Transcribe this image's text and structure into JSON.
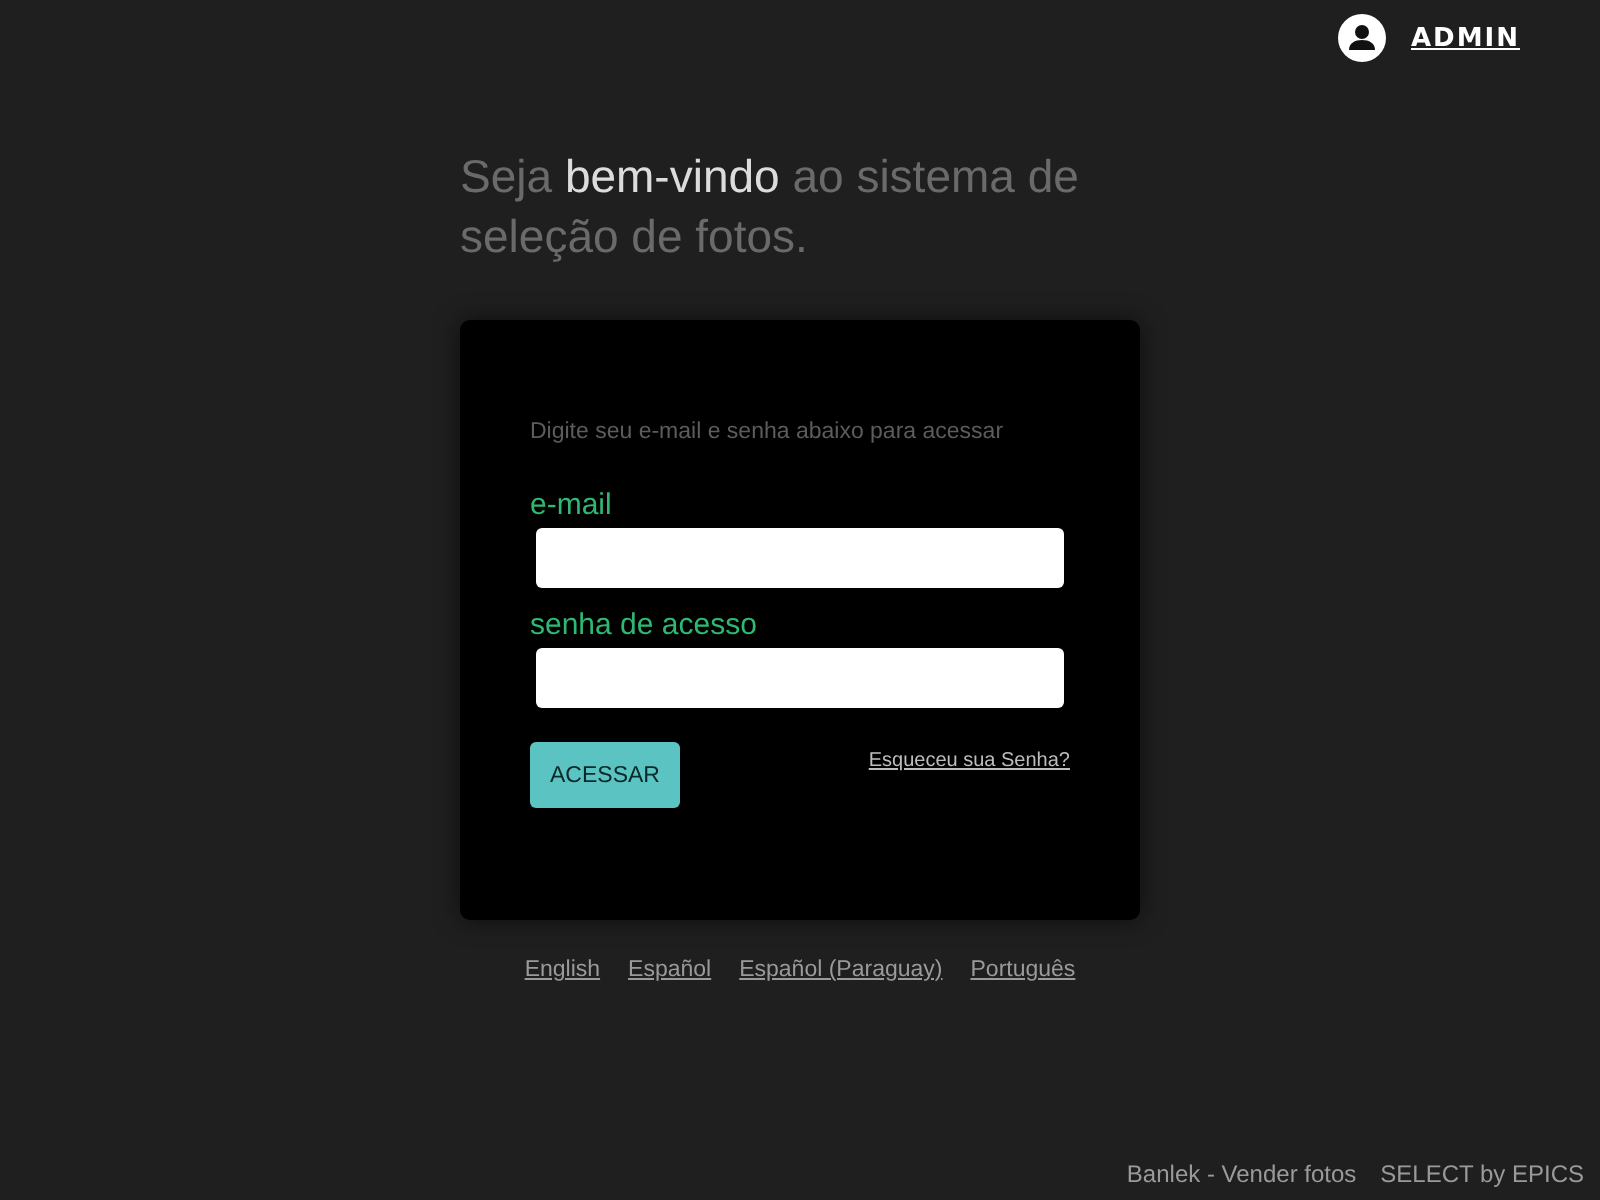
{
  "header": {
    "user": "ADMIN"
  },
  "welcome": "Seja **bem-vindo** ao sistema de seleção de fotos.",
  "login": {
    "instructions": "Digite seu e-mail e senha abaixo para acessar",
    "fields": [
      {
        "label": "e-mail"
      },
      {
        "label": "senha de acesso"
      }
    ],
    "forgot_link": "Esqueceu sua Senha?",
    "submit": "ACESSAR"
  },
  "languages": [
    "English",
    "Español",
    "Español (Paraguay)",
    "Português"
  ],
  "footer": [
    "Banlek - Vender fotos",
    "SELECT by EPICS"
  ]
}
